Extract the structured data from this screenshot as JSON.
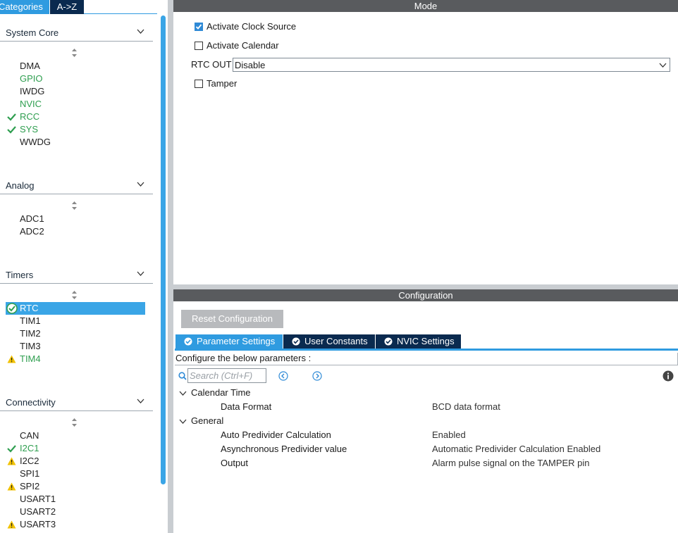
{
  "left_panel": {
    "tabs": {
      "categories": "Categories",
      "az": "A->Z"
    },
    "sections": [
      {
        "title": "System Core",
        "items": [
          {
            "label": "DMA",
            "status": "none"
          },
          {
            "label": "GPIO",
            "status": "green"
          },
          {
            "label": "IWDG",
            "status": "none"
          },
          {
            "label": "NVIC",
            "status": "green"
          },
          {
            "label": "RCC",
            "status": "check"
          },
          {
            "label": "SYS",
            "status": "check"
          },
          {
            "label": "WWDG",
            "status": "none"
          }
        ]
      },
      {
        "title": "Analog",
        "items": [
          {
            "label": "ADC1",
            "status": "none"
          },
          {
            "label": "ADC2",
            "status": "none"
          }
        ]
      },
      {
        "title": "Timers",
        "items": [
          {
            "label": "RTC",
            "status": "selected"
          },
          {
            "label": "TIM1",
            "status": "none"
          },
          {
            "label": "TIM2",
            "status": "none"
          },
          {
            "label": "TIM3",
            "status": "none"
          },
          {
            "label": "TIM4",
            "status": "warning"
          }
        ]
      },
      {
        "title": "Connectivity",
        "items": [
          {
            "label": "CAN",
            "status": "none"
          },
          {
            "label": "I2C1",
            "status": "check"
          },
          {
            "label": "I2C2",
            "status": "warning-dark"
          },
          {
            "label": "SPI1",
            "status": "none"
          },
          {
            "label": "SPI2",
            "status": "warning-dark"
          },
          {
            "label": "USART1",
            "status": "none"
          },
          {
            "label": "USART2",
            "status": "none"
          },
          {
            "label": "USART3",
            "status": "warning-dark"
          }
        ]
      }
    ]
  },
  "mode": {
    "title": "Mode",
    "activate_clock_source": {
      "label": "Activate Clock Source",
      "checked": true
    },
    "activate_calendar": {
      "label": "Activate Calendar",
      "checked": false
    },
    "rtc_out": {
      "label": "RTC OUT",
      "value": "Disable"
    },
    "tamper": {
      "label": "Tamper",
      "checked": false
    }
  },
  "configuration": {
    "title": "Configuration",
    "reset_button": "Reset Configuration",
    "tabs": [
      "Parameter Settings",
      "User Constants",
      "NVIC Settings"
    ],
    "active_tab": "Parameter Settings",
    "caption": "Configure the below parameters :",
    "search_placeholder": "Search (Ctrl+F)",
    "groups": [
      {
        "name": "Calendar Time",
        "params": [
          {
            "name": "Data Format",
            "value": "BCD data format"
          }
        ]
      },
      {
        "name": "General",
        "params": [
          {
            "name": "Auto Predivider Calculation",
            "value": "Enabled"
          },
          {
            "name": "Asynchronous Predivider value",
            "value": "Automatic Predivider Calculation Enabled"
          },
          {
            "name": "Output",
            "value": "Alarm pulse signal on the TAMPER pin"
          }
        ]
      }
    ]
  },
  "colors": {
    "accent": "#2f9be0",
    "navy": "#0a2a4f",
    "ok_green": "#2e9e4f",
    "warning": "#f2c200",
    "band": "#595b5e"
  }
}
